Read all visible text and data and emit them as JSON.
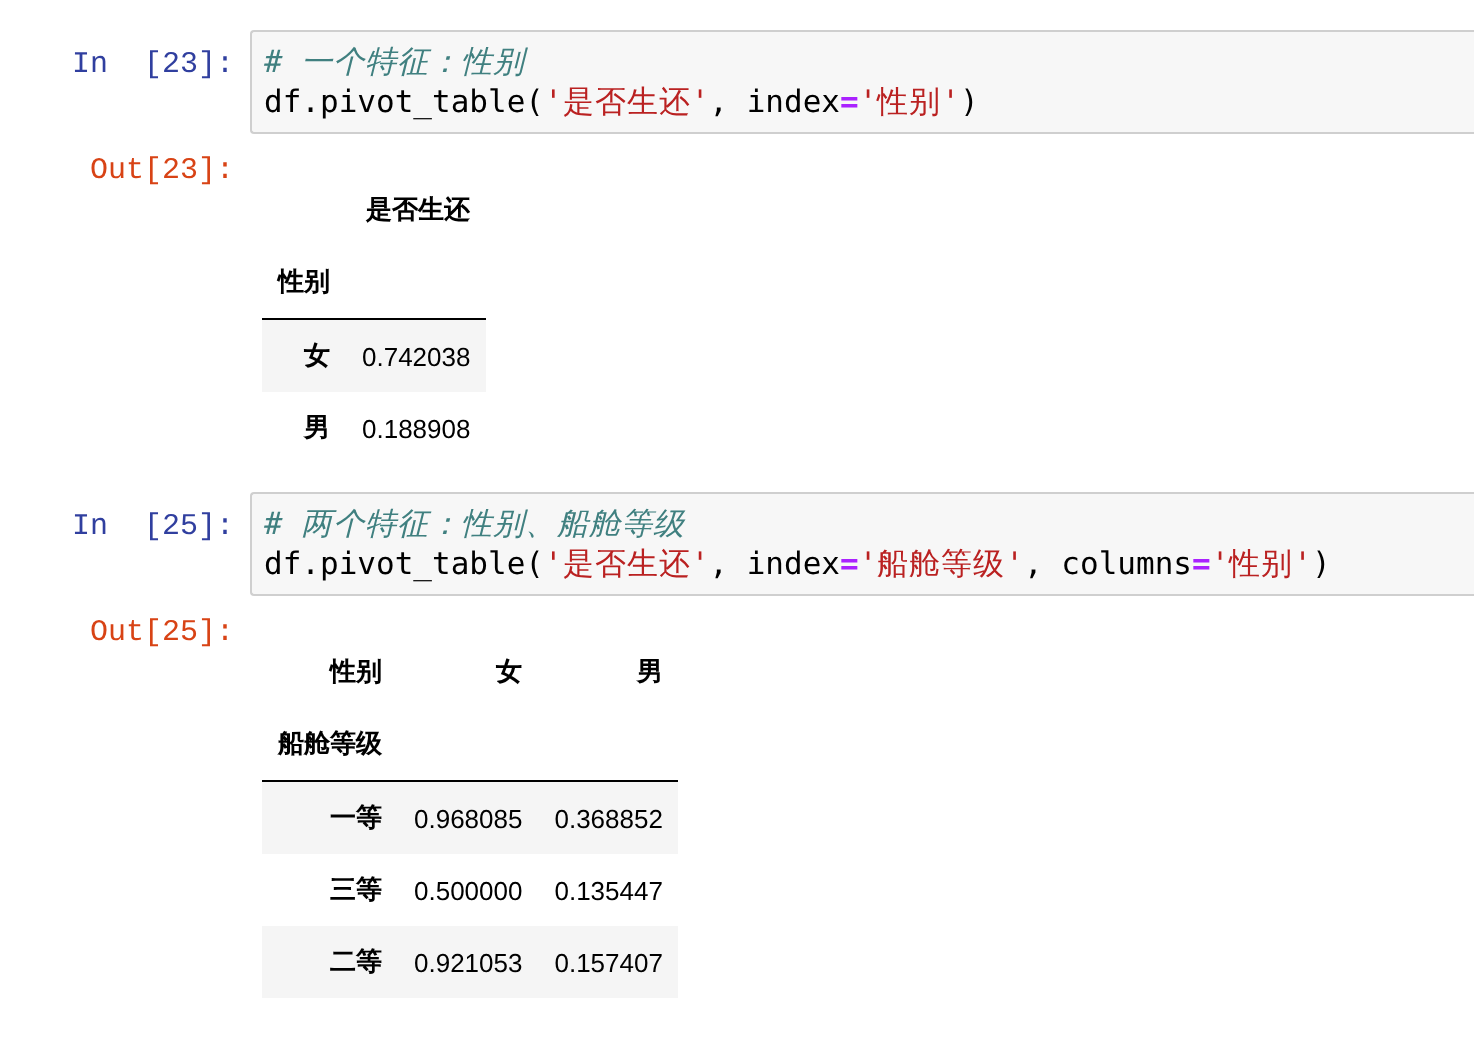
{
  "cells": [
    {
      "in_prompt": "In  [23]:",
      "comment": "# 一个特征：性别",
      "code": [
        {
          "kind": "plain",
          "text": "df.pivot_table("
        },
        {
          "kind": "string",
          "text": "'是否生还'"
        },
        {
          "kind": "plain",
          "text": ", index"
        },
        {
          "kind": "operator",
          "text": "="
        },
        {
          "kind": "string",
          "text": "'性别'"
        },
        {
          "kind": "plain",
          "text": ")"
        }
      ],
      "out_prompt": "Out[23]:",
      "table": {
        "header_rows": [
          [
            "",
            "是否生还"
          ],
          [
            "性别",
            ""
          ]
        ],
        "rows": [
          {
            "index": "女",
            "values": [
              "0.742038"
            ]
          },
          {
            "index": "男",
            "values": [
              "0.188908"
            ]
          }
        ]
      }
    },
    {
      "in_prompt": "In  [25]:",
      "comment": "# 两个特征：性别、船舱等级",
      "code": [
        {
          "kind": "plain",
          "text": "df.pivot_table("
        },
        {
          "kind": "string",
          "text": "'是否生还'"
        },
        {
          "kind": "plain",
          "text": ", index"
        },
        {
          "kind": "operator",
          "text": "="
        },
        {
          "kind": "string",
          "text": "'船舱等级'"
        },
        {
          "kind": "plain",
          "text": ", columns"
        },
        {
          "kind": "operator",
          "text": "="
        },
        {
          "kind": "string",
          "text": "'性别'"
        },
        {
          "kind": "plain",
          "text": ")"
        }
      ],
      "out_prompt": "Out[25]:",
      "table": {
        "header_rows": [
          [
            "性别",
            "女",
            "男"
          ],
          [
            "船舱等级",
            "",
            ""
          ]
        ],
        "rows": [
          {
            "index": "一等",
            "values": [
              "0.968085",
              "0.368852"
            ]
          },
          {
            "index": "三等",
            "values": [
              "0.500000",
              "0.135447"
            ]
          },
          {
            "index": "二等",
            "values": [
              "0.921053",
              "0.157407"
            ]
          }
        ]
      }
    }
  ]
}
